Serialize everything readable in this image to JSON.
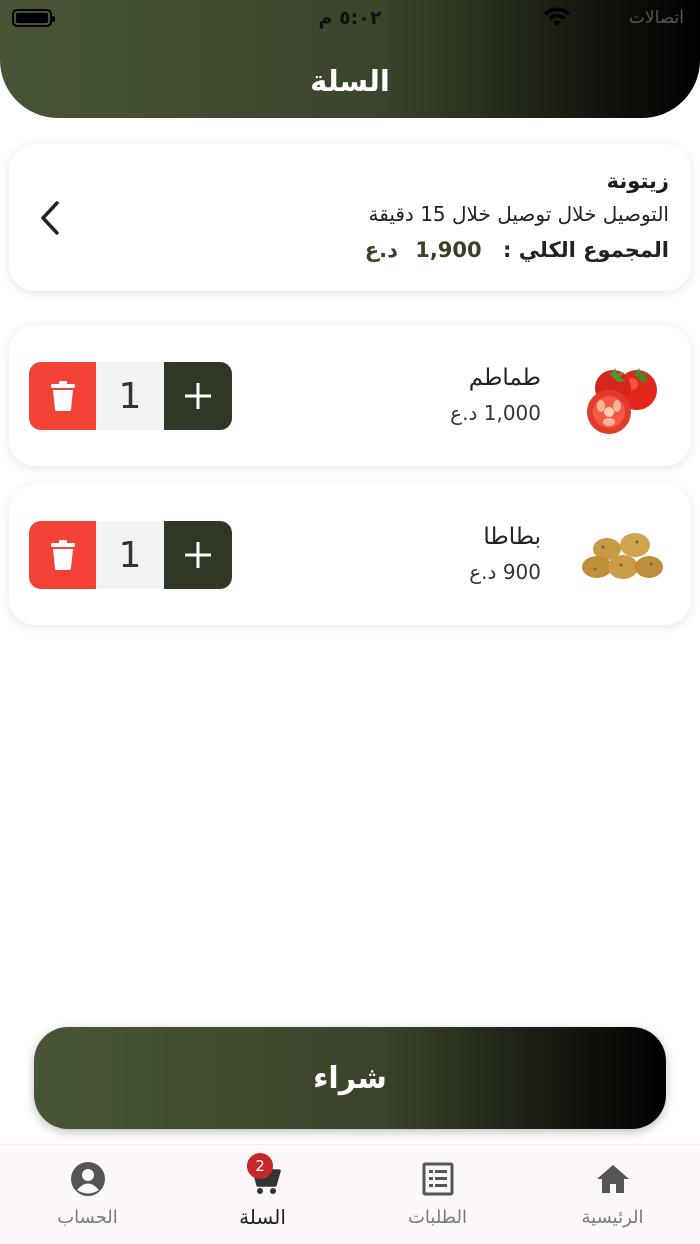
{
  "status_bar": {
    "time": "٥:٠٢ م",
    "carrier": "اتصالات"
  },
  "header": {
    "title": "السلة"
  },
  "store": {
    "name": "زيتونة",
    "delivery": "التوصيل خلال توصيل خلال 15 دقيقة",
    "total_label": "المجموع الكلي",
    "total_separator": ":",
    "total_amount": "1,900",
    "currency": "د.ع"
  },
  "items": [
    {
      "name": "طماطم",
      "price": "1,000 د.ع",
      "quantity": "1",
      "image": "tomato"
    },
    {
      "name": "بطاطا",
      "price": "900 د.ع",
      "quantity": "1",
      "image": "potato"
    }
  ],
  "buy_button": {
    "label": "شراء"
  },
  "tabbar": {
    "tabs": [
      {
        "label": "الرئيسية",
        "icon": "home-icon"
      },
      {
        "label": "الطلبات",
        "icon": "orders-icon"
      },
      {
        "label": "السلة",
        "icon": "cart-icon",
        "badge": "2",
        "active": true
      },
      {
        "label": "الحساب",
        "icon": "account-icon"
      }
    ]
  },
  "colors": {
    "brand": "#485535",
    "brand_dark": "#2f3824",
    "delete": "#f34336",
    "badge": "#c62828"
  }
}
